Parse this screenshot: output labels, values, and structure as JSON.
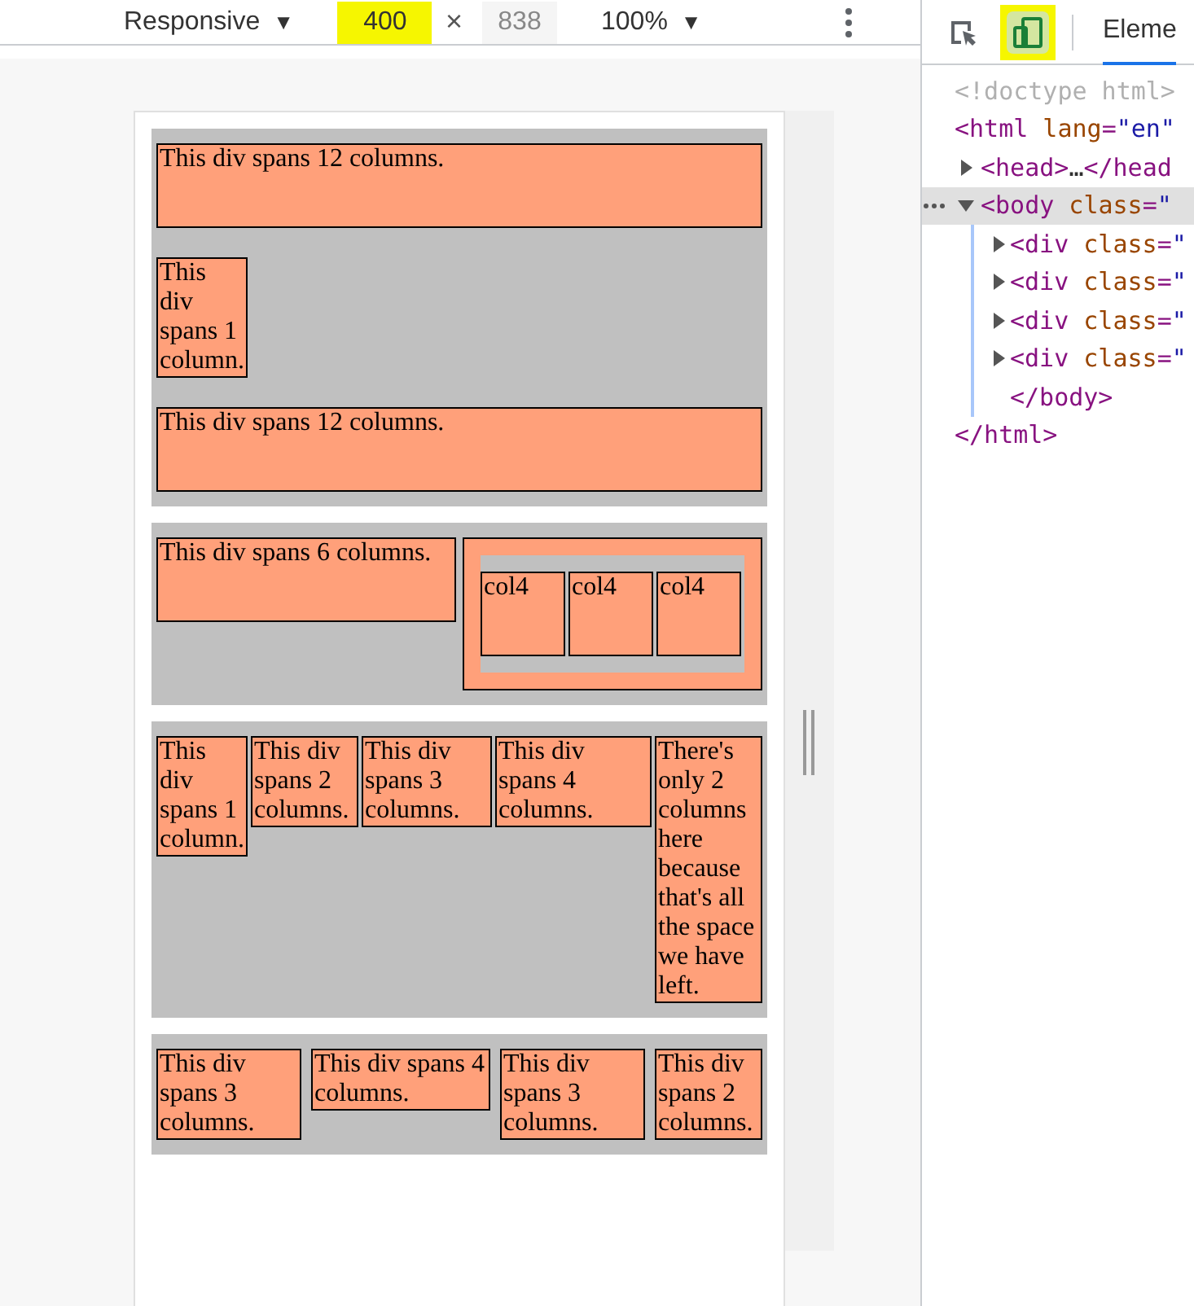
{
  "toolbar": {
    "device": "Responsive",
    "caret": "▼",
    "width": {
      "value": "400",
      "highlighted": true
    },
    "times": "×",
    "height": {
      "value": "838",
      "highlighted": false
    },
    "zoom": "100%",
    "zoom_caret": "▼"
  },
  "devtools": {
    "tools": [
      {
        "kind": "inspect",
        "selected": false,
        "highlighted": false
      },
      {
        "kind": "device",
        "selected": true,
        "highlighted": true
      }
    ],
    "tabs": [
      {
        "label": "Eleme",
        "selected": true
      }
    ],
    "dom": [
      {
        "parts": [
          {
            "kind": "doctype",
            "text": "<!doctype html>"
          }
        ]
      },
      {
        "parts": [
          {
            "kind": "tag",
            "text": "<html"
          },
          {
            "kind": "attr",
            "text": " lang"
          },
          {
            "kind": "tag",
            "text": "="
          },
          {
            "kind": "value",
            "text": "\"en\""
          }
        ],
        "children": [
          {
            "expanded": false,
            "parts": [
              {
                "kind": "tag",
                "text": "<head>"
              },
              {
                "kind": "plain",
                "text": "…"
              },
              {
                "kind": "tag",
                "text": "</head"
              }
            ]
          },
          {
            "expanded": true,
            "selected": true,
            "parts": [
              {
                "kind": "tag",
                "text": "<body"
              },
              {
                "kind": "attr",
                "text": " class"
              },
              {
                "kind": "tag",
                "text": "="
              },
              {
                "kind": "value",
                "text": "\""
              }
            ],
            "children": [
              {
                "expanded": false,
                "parts": [
                  {
                    "kind": "tag",
                    "text": "<div"
                  },
                  {
                    "kind": "attr",
                    "text": " class"
                  },
                  {
                    "kind": "tag",
                    "text": "="
                  },
                  {
                    "kind": "value",
                    "text": "\""
                  }
                ]
              },
              {
                "expanded": false,
                "parts": [
                  {
                    "kind": "tag",
                    "text": "<div"
                  },
                  {
                    "kind": "attr",
                    "text": " class"
                  },
                  {
                    "kind": "tag",
                    "text": "="
                  },
                  {
                    "kind": "value",
                    "text": "\""
                  }
                ]
              },
              {
                "expanded": false,
                "parts": [
                  {
                    "kind": "tag",
                    "text": "<div"
                  },
                  {
                    "kind": "attr",
                    "text": " class"
                  },
                  {
                    "kind": "tag",
                    "text": "="
                  },
                  {
                    "kind": "value",
                    "text": "\""
                  }
                ]
              },
              {
                "expanded": false,
                "parts": [
                  {
                    "kind": "tag",
                    "text": "<div"
                  },
                  {
                    "kind": "attr",
                    "text": " class"
                  },
                  {
                    "kind": "tag",
                    "text": "="
                  },
                  {
                    "kind": "value",
                    "text": "\""
                  }
                ]
              },
              {
                "parts": [
                  {
                    "kind": "tag",
                    "text": "</body>"
                  }
                ]
              }
            ]
          }
        ]
      },
      {
        "parts": [
          {
            "kind": "tag",
            "text": "</html>"
          }
        ]
      }
    ]
  },
  "page": {
    "sections": [
      {
        "rows": [
          [
            {
              "kind": "col12",
              "text": "This div spans 12 columns."
            }
          ],
          [
            {
              "kind": "col1",
              "text": "This div spans 1 column."
            }
          ],
          [
            {
              "kind": "col12",
              "text": "This div spans 12 columns."
            }
          ]
        ]
      },
      {
        "rows": [
          [
            {
              "kind": "col6",
              "text": "This div spans 6 columns."
            },
            {
              "kind": "nested",
              "children": [
                {
                  "kind": "inner4",
                  "text": "col4"
                },
                {
                  "kind": "inner4",
                  "text": "col4"
                },
                {
                  "kind": "inner4",
                  "text": "col4"
                }
              ]
            }
          ]
        ]
      },
      {
        "rows": [
          [
            {
              "kind": "col1",
              "text": "This div spans 1 column."
            },
            {
              "kind": "col2",
              "text": "This div spans 2 columns."
            },
            {
              "kind": "col3",
              "text": "This div spans 3 columns."
            },
            {
              "kind": "col4",
              "text": "This div spans 4 columns."
            },
            {
              "kind": "col2",
              "text": "There's only 2 columns here because that's all the space we have left."
            }
          ]
        ]
      },
      {
        "rows": [
          [
            {
              "kind": "col3",
              "text": "This div spans 3 columns."
            },
            {
              "kind": "col4",
              "text": "This div spans 4 columns."
            },
            {
              "kind": "col3",
              "text": "This div spans 3 columns."
            },
            {
              "kind": "col2",
              "text": "This div spans 2 columns."
            }
          ]
        ]
      }
    ]
  }
}
